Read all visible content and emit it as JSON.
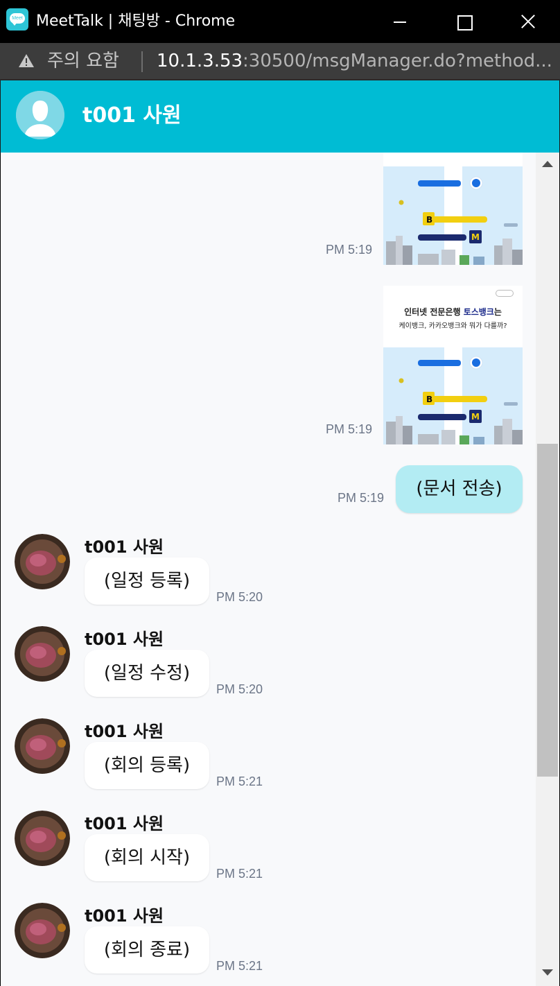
{
  "window": {
    "title": "MeetTalk | 채팅방 - Chrome",
    "icon_text": "Meet"
  },
  "address_bar": {
    "warning_label": "주의 요함",
    "url_host": "10.1.3.53",
    "url_path": ":30500/msgManager.do?method..."
  },
  "header": {
    "title": "t001 사원"
  },
  "messages": {
    "sent": [
      {
        "type": "image",
        "time": "PM 5:19"
      },
      {
        "type": "image",
        "time": "PM 5:19",
        "banner_text_1": "인터넷 전문은행",
        "banner_text_1_bold": "토스뱅크",
        "banner_text_1_tail": "는",
        "banner_text_2": "케이뱅크, 카카오뱅크와 뭐가 다를까?"
      },
      {
        "type": "text",
        "text": "(문서 전송)",
        "time": "PM 5:19"
      }
    ],
    "received": [
      {
        "sender": "t001 사원",
        "text": "(일정 등록)",
        "time": "PM 5:20"
      },
      {
        "sender": "t001 사원",
        "text": "(일정 수정)",
        "time": "PM 5:20"
      },
      {
        "sender": "t001 사원",
        "text": "(회의 등록)",
        "time": "PM 5:21"
      },
      {
        "sender": "t001 사원",
        "text": "(회의 시작)",
        "time": "PM 5:21"
      },
      {
        "sender": "t001 사원",
        "text": "(회의 종료)",
        "time": "PM 5:21"
      }
    ]
  },
  "colors": {
    "header_bg": "#00bcd4",
    "sent_bubble": "#b3ecf3",
    "received_bubble": "#ffffff",
    "chat_bg": "#f8f9fb"
  },
  "icons": {
    "app": "meettalk-app-icon",
    "security": "warning-triangle-icon",
    "header_avatar": "default-user-avatar-icon"
  }
}
